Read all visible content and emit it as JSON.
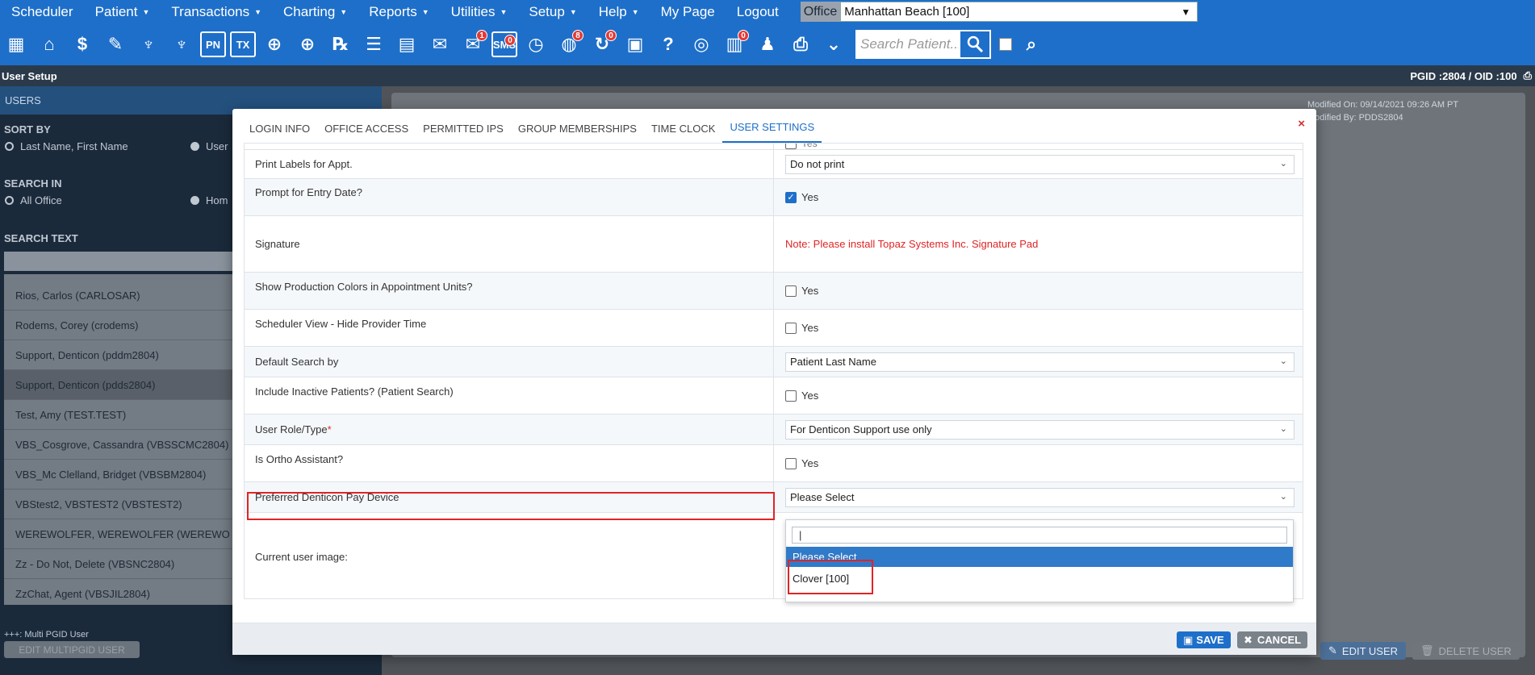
{
  "menu": {
    "items": [
      {
        "label": "Scheduler",
        "caret": false
      },
      {
        "label": "Patient",
        "caret": true
      },
      {
        "label": "Transactions",
        "caret": true
      },
      {
        "label": "Charting",
        "caret": true
      },
      {
        "label": "Reports",
        "caret": true
      },
      {
        "label": "Utilities",
        "caret": true
      },
      {
        "label": "Setup",
        "caret": true
      },
      {
        "label": "Help",
        "caret": true
      },
      {
        "label": "My Page",
        "caret": false
      },
      {
        "label": "Logout",
        "caret": false
      }
    ],
    "office_label": "Office",
    "office_value": "Manhattan Beach [100]"
  },
  "toolbar": {
    "search_placeholder": "Search Patient...",
    "badges": {
      "messages": "1",
      "sms": "0",
      "web": "8",
      "recall": "0",
      "docs": "0"
    },
    "sms_label": "SMS",
    "pn_label": "PN",
    "tx_label": "TX"
  },
  "subbar": {
    "title": "User Setup",
    "pgid": "PGID :2804  /  OID :100"
  },
  "left": {
    "header": "USERS",
    "sort_by": "SORT BY",
    "sort_opt1": "Last Name, First Name",
    "sort_opt2": "User",
    "search_in": "SEARCH IN",
    "search_opt1": "All Office",
    "search_opt2": "Hom",
    "search_text": "SEARCH TEXT",
    "users": [
      "Rios, Carlos (CARLOSAR)",
      "Rodems, Corey (crodems)",
      "Support, Denticon (pddm2804)",
      "Support, Denticon (pdds2804)",
      "Test, Amy (TEST.TEST)",
      "VBS_Cosgrove, Cassandra (VBSSCMC2804)",
      "VBS_Mc Clelland, Bridget (VBSBM2804)",
      "VBStest2, VBSTEST2 (VBSTEST2)",
      "WEREWOLFER, WEREWOLFER (WEREWO",
      "Zz - Do Not, Delete (VBSNC2804)",
      "ZzChat, Agent (VBSJIL2804)"
    ],
    "multi_label": "+++: Multi PGID User",
    "multi_btn": "EDIT MULTIPGID USER"
  },
  "right": {
    "modified_on": "Modified On: 09/14/2021 09:26 AM PT",
    "modified_by": "Modified By: PDDS2804",
    "edit_user": "EDIT USER",
    "delete_user": "DELETE USER"
  },
  "modal": {
    "tabs": [
      "LOGIN INFO",
      "OFFICE ACCESS",
      "PERMITTED IPS",
      "GROUP MEMBERSHIPS",
      "TIME CLOCK",
      "USER SETTINGS"
    ],
    "close": "×",
    "top_partial": "Yes",
    "rows": {
      "print_labels": {
        "label": "Print Labels for Appt.",
        "value": "Do not print"
      },
      "prompt_entry": {
        "label": "Prompt for Entry Date?",
        "value": "Yes"
      },
      "signature": {
        "label": "Signature",
        "value": "Note: Please install Topaz Systems Inc. Signature Pad"
      },
      "prod_colors": {
        "label": "Show Production Colors in Appointment Units?",
        "value": "Yes"
      },
      "hide_provider": {
        "label": "Scheduler View - Hide Provider Time",
        "value": "Yes"
      },
      "default_search": {
        "label": "Default Search by",
        "value": "Patient Last Name"
      },
      "inactive": {
        "label": "Include Inactive Patients? (Patient Search)",
        "value": "Yes"
      },
      "role": {
        "label": "User Role/Type",
        "req": "*",
        "value": "For Denticon Support use only"
      },
      "ortho": {
        "label": "Is Ortho Assistant?",
        "value": "Yes"
      },
      "pay_device": {
        "label": "Preferred Denticon Pay Device",
        "value": "Please Select"
      },
      "user_image": {
        "label": "Current user image:"
      }
    },
    "dropdown": {
      "search_value": "|",
      "options": [
        "Please Select",
        "Clover [100]"
      ]
    },
    "save": "SAVE",
    "cancel": "CANCEL"
  },
  "colors": {
    "brand": "#1e6fc9",
    "danger": "#e02424"
  }
}
